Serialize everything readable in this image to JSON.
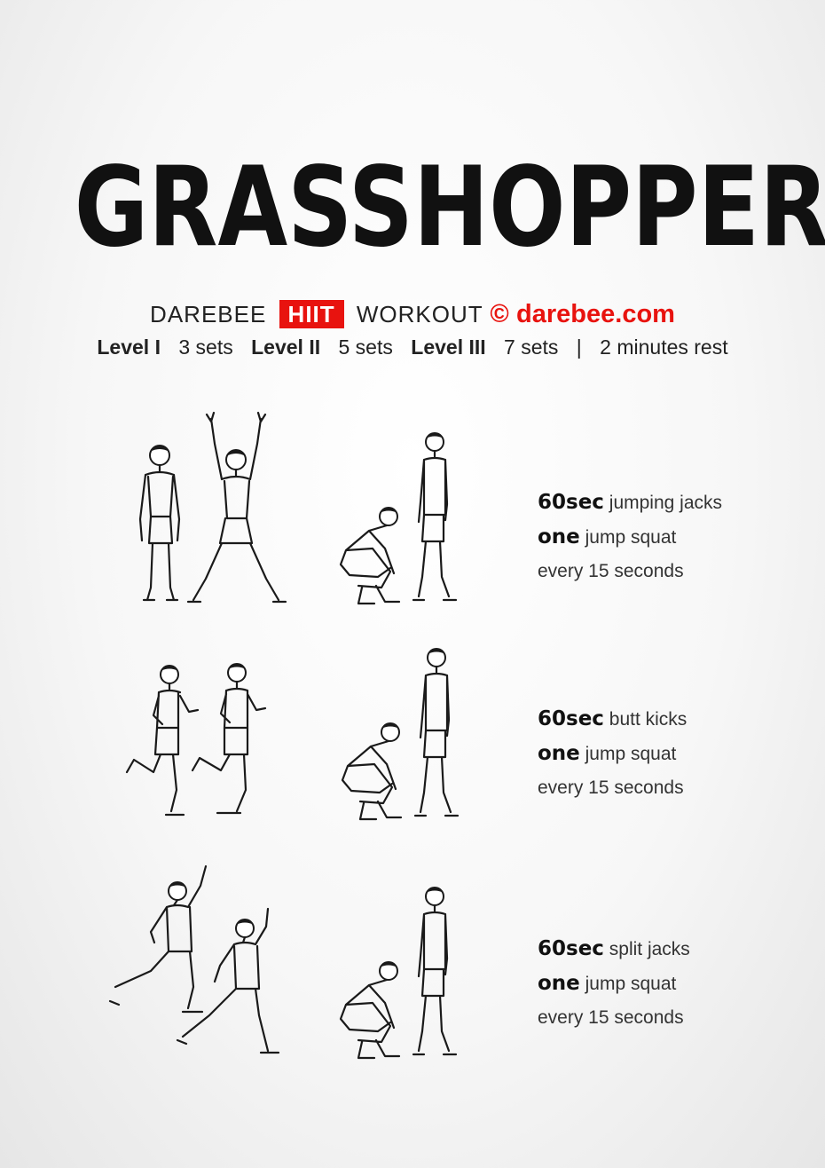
{
  "title": "GRASSHOPPER",
  "brand": {
    "darebee": "DAREBEE",
    "hiit": "HIIT",
    "workout": "WORKOUT",
    "copyright": "©",
    "site": "darebee.com",
    "accent_color": "#e8130f"
  },
  "levels": {
    "level1_label": "Level I",
    "level1_sets": "3 sets",
    "level2_label": "Level II",
    "level2_sets": "5 sets",
    "level3_label": "Level III",
    "level3_sets": "7 sets",
    "separator": "|",
    "rest": "2 minutes rest"
  },
  "exercises": [
    {
      "duration": "60sec",
      "name": "jumping jacks",
      "count": "one",
      "move": "jump squat",
      "frequency": "every 15 seconds"
    },
    {
      "duration": "60sec",
      "name": "butt kicks",
      "count": "one",
      "move": "jump squat",
      "frequency": "every 15 seconds"
    },
    {
      "duration": "60sec",
      "name": "split jacks",
      "count": "one",
      "move": "jump squat",
      "frequency": "every 15 seconds"
    }
  ]
}
